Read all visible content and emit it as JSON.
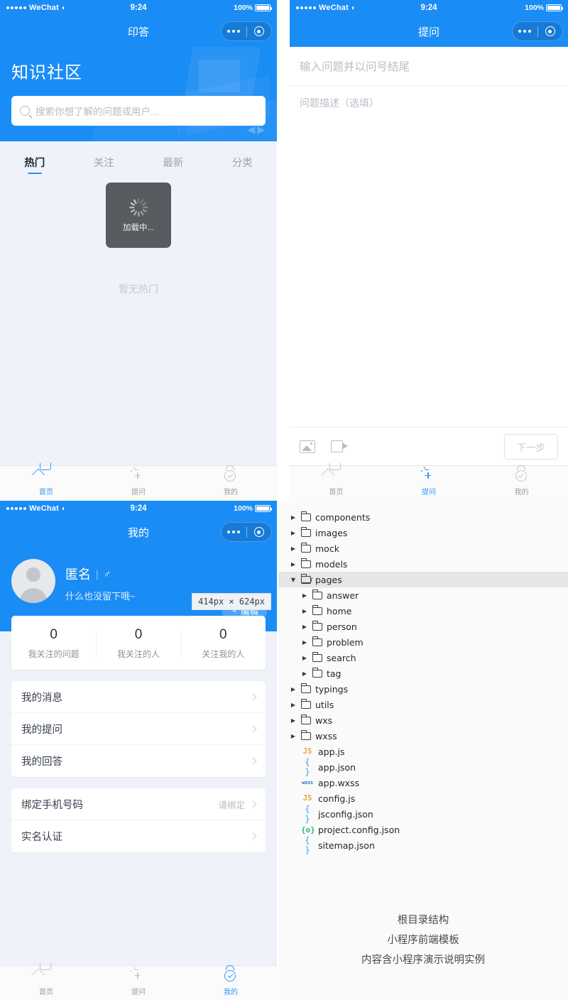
{
  "status_bar": {
    "carrier": "WeChat",
    "time": "9:24",
    "battery": "100%"
  },
  "panel_home": {
    "nav_title": "印答",
    "hero_title": "知识社区",
    "search_placeholder": "搜索你想了解的问题或用户...",
    "tabs": [
      {
        "label": "热门",
        "active": true
      },
      {
        "label": "关注",
        "active": false
      },
      {
        "label": "最新",
        "active": false
      },
      {
        "label": "分类",
        "active": false
      }
    ],
    "toast_text": "加载中...",
    "empty_text": "暂无热门"
  },
  "panel_ask": {
    "nav_title": "提问",
    "title_placeholder": "输入问题并以问号结尾",
    "desc_placeholder": "问题描述（选填）",
    "toolbar": {
      "image_icon": "image-icon",
      "video_icon": "video-icon",
      "next_label": "下一步"
    }
  },
  "panel_profile": {
    "nav_title": "我的",
    "user_name": "匿名",
    "separator": "|",
    "gender_symbol": "♂",
    "signature": "什么也没留下哦~",
    "edit_label": "编辑",
    "edit_icon": "pencil-icon",
    "size_tip": "414px × 624px",
    "stats": [
      {
        "value": "0",
        "label": "我关注的问题"
      },
      {
        "value": "0",
        "label": "我关注的人"
      },
      {
        "value": "0",
        "label": "关注我的人"
      }
    ],
    "menu_group_1": [
      {
        "label": "我的消息",
        "extra": ""
      },
      {
        "label": "我的提问",
        "extra": ""
      },
      {
        "label": "我的回答",
        "extra": ""
      }
    ],
    "menu_group_2": [
      {
        "label": "绑定手机号码",
        "extra": "请绑定"
      },
      {
        "label": "实名认证",
        "extra": ""
      }
    ]
  },
  "tabbar": {
    "home": {
      "label": "首页",
      "icon": "home-icon"
    },
    "ask": {
      "label": "提问",
      "icon": "ask-bubble-icon"
    },
    "me": {
      "label": "我的",
      "icon": "user-badge-icon"
    }
  },
  "file_tree": {
    "nodes": [
      {
        "name": "components",
        "type": "folder",
        "depth": 0,
        "open": false,
        "selected": false
      },
      {
        "name": "images",
        "type": "folder",
        "depth": 0,
        "open": false,
        "selected": false
      },
      {
        "name": "mock",
        "type": "folder",
        "depth": 0,
        "open": false,
        "selected": false
      },
      {
        "name": "models",
        "type": "folder",
        "depth": 0,
        "open": false,
        "selected": false
      },
      {
        "name": "pages",
        "type": "folder",
        "depth": 0,
        "open": true,
        "selected": true
      },
      {
        "name": "answer",
        "type": "folder",
        "depth": 1,
        "open": false,
        "selected": false
      },
      {
        "name": "home",
        "type": "folder",
        "depth": 1,
        "open": false,
        "selected": false
      },
      {
        "name": "person",
        "type": "folder",
        "depth": 1,
        "open": false,
        "selected": false
      },
      {
        "name": "problem",
        "type": "folder",
        "depth": 1,
        "open": false,
        "selected": false
      },
      {
        "name": "search",
        "type": "folder",
        "depth": 1,
        "open": false,
        "selected": false
      },
      {
        "name": "tag",
        "type": "folder",
        "depth": 1,
        "open": false,
        "selected": false
      },
      {
        "name": "typings",
        "type": "folder",
        "depth": 0,
        "open": false,
        "selected": false
      },
      {
        "name": "utils",
        "type": "folder",
        "depth": 0,
        "open": false,
        "selected": false
      },
      {
        "name": "wxs",
        "type": "folder",
        "depth": 0,
        "open": false,
        "selected": false
      },
      {
        "name": "wxss",
        "type": "folder",
        "depth": 0,
        "open": false,
        "selected": false
      },
      {
        "name": "app.js",
        "type": "js",
        "depth": 0,
        "badge": "JS"
      },
      {
        "name": "app.json",
        "type": "json",
        "depth": 0,
        "badge": "{ }"
      },
      {
        "name": "app.wxss",
        "type": "wxss",
        "depth": 0,
        "badge": "wxss"
      },
      {
        "name": "config.js",
        "type": "js",
        "depth": 0,
        "badge": "JS"
      },
      {
        "name": "jsconfig.json",
        "type": "json",
        "depth": 0,
        "badge": "{ }"
      },
      {
        "name": "project.config.json",
        "type": "proj",
        "depth": 0,
        "badge": "{o}"
      },
      {
        "name": "sitemap.json",
        "type": "json",
        "depth": 0,
        "badge": "{ }"
      }
    ],
    "caption_lines": [
      "根目录结构",
      "小程序前端模板",
      "内容含小程序演示说明实例"
    ]
  },
  "colors": {
    "brand_blue": "#1a8cf5",
    "active_tab": "#3296fa",
    "page_bg": "#eff3f9",
    "toast_bg": "#585c61"
  }
}
